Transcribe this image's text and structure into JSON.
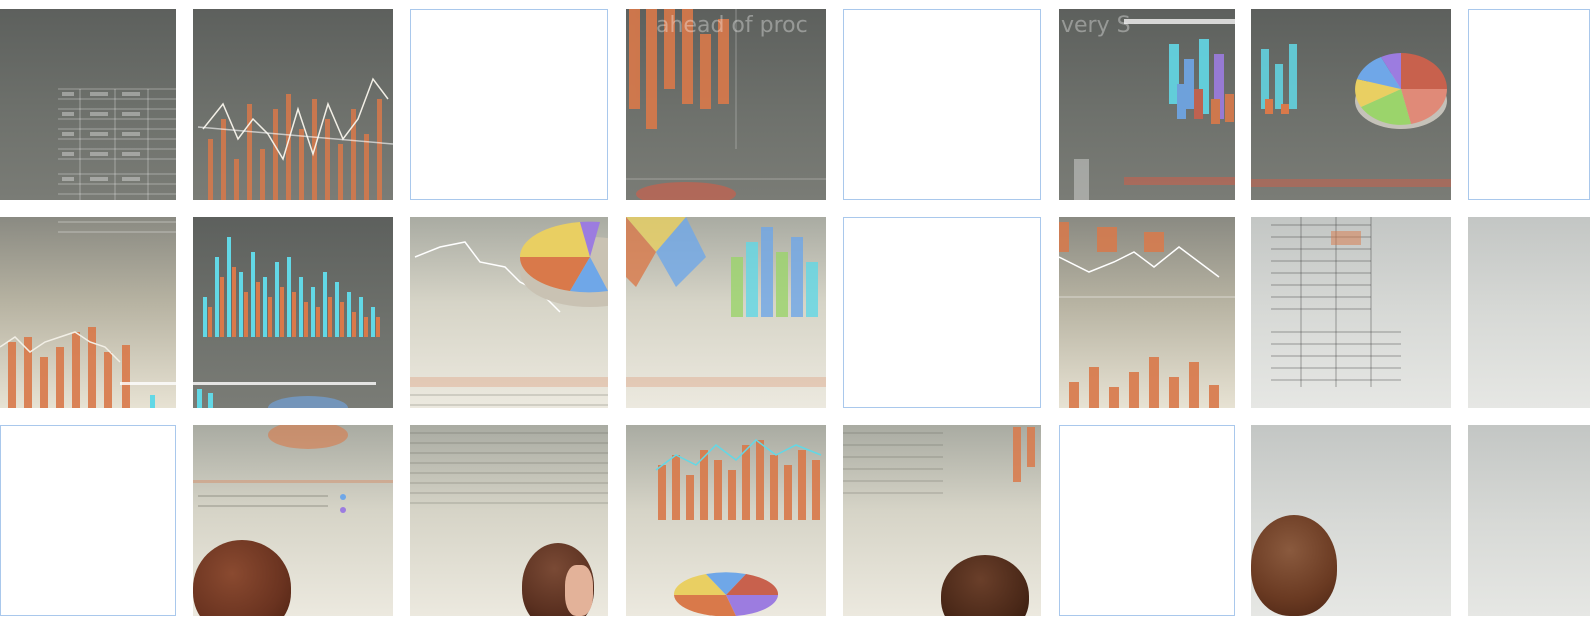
{
  "puzzle": {
    "rows": 3,
    "cols": 8,
    "colors": {
      "blank_border": "#a9c8ec",
      "bar_orange": "#d9794a",
      "bar_cyan": "#62d8e6",
      "line_white": "#f2efe6",
      "pie_blue": "#6fa7e8",
      "pie_red": "#c8614d",
      "pie_green": "#9bd46b",
      "pie_yellow": "#e9cf62",
      "pie_purple": "#9c7ce0"
    },
    "overlay_text": {
      "ahead": "ahead of proc",
      "very": "very S"
    }
  },
  "tiles": [
    {
      "id": "r1c1",
      "blank": false,
      "kind": "table"
    },
    {
      "id": "r1c2",
      "blank": false,
      "kind": "bar-line"
    },
    {
      "id": "r1c3",
      "blank": true
    },
    {
      "id": "r1c4",
      "blank": false,
      "kind": "bars-text"
    },
    {
      "id": "r1c5",
      "blank": true
    },
    {
      "id": "r1c6",
      "blank": false,
      "kind": "3d-bars"
    },
    {
      "id": "r1c7",
      "blank": false,
      "kind": "pie"
    },
    {
      "id": "r1c8",
      "blank": true
    },
    {
      "id": "r2c1",
      "blank": false,
      "kind": "bars-line-low"
    },
    {
      "id": "r2c2",
      "blank": false,
      "kind": "cyan-bars"
    },
    {
      "id": "r2c3",
      "blank": false,
      "kind": "line-pie"
    },
    {
      "id": "r2c4",
      "blank": false,
      "kind": "pie-bars"
    },
    {
      "id": "r2c5",
      "blank": true
    },
    {
      "id": "r2c6",
      "blank": false,
      "kind": "line-bars"
    },
    {
      "id": "r2c7",
      "blank": false,
      "kind": "table"
    },
    {
      "id": "r2c8",
      "blank": false,
      "kind": "mist"
    },
    {
      "id": "r3c1",
      "blank": true
    },
    {
      "id": "r3c2",
      "blank": false,
      "kind": "person"
    },
    {
      "id": "r3c3",
      "blank": false,
      "kind": "person"
    },
    {
      "id": "r3c4",
      "blank": false,
      "kind": "bars-pie"
    },
    {
      "id": "r3c5",
      "blank": false,
      "kind": "person"
    },
    {
      "id": "r3c6",
      "blank": true
    },
    {
      "id": "r3c7",
      "blank": false,
      "kind": "person"
    },
    {
      "id": "r3c8",
      "blank": false,
      "kind": "mist"
    }
  ]
}
